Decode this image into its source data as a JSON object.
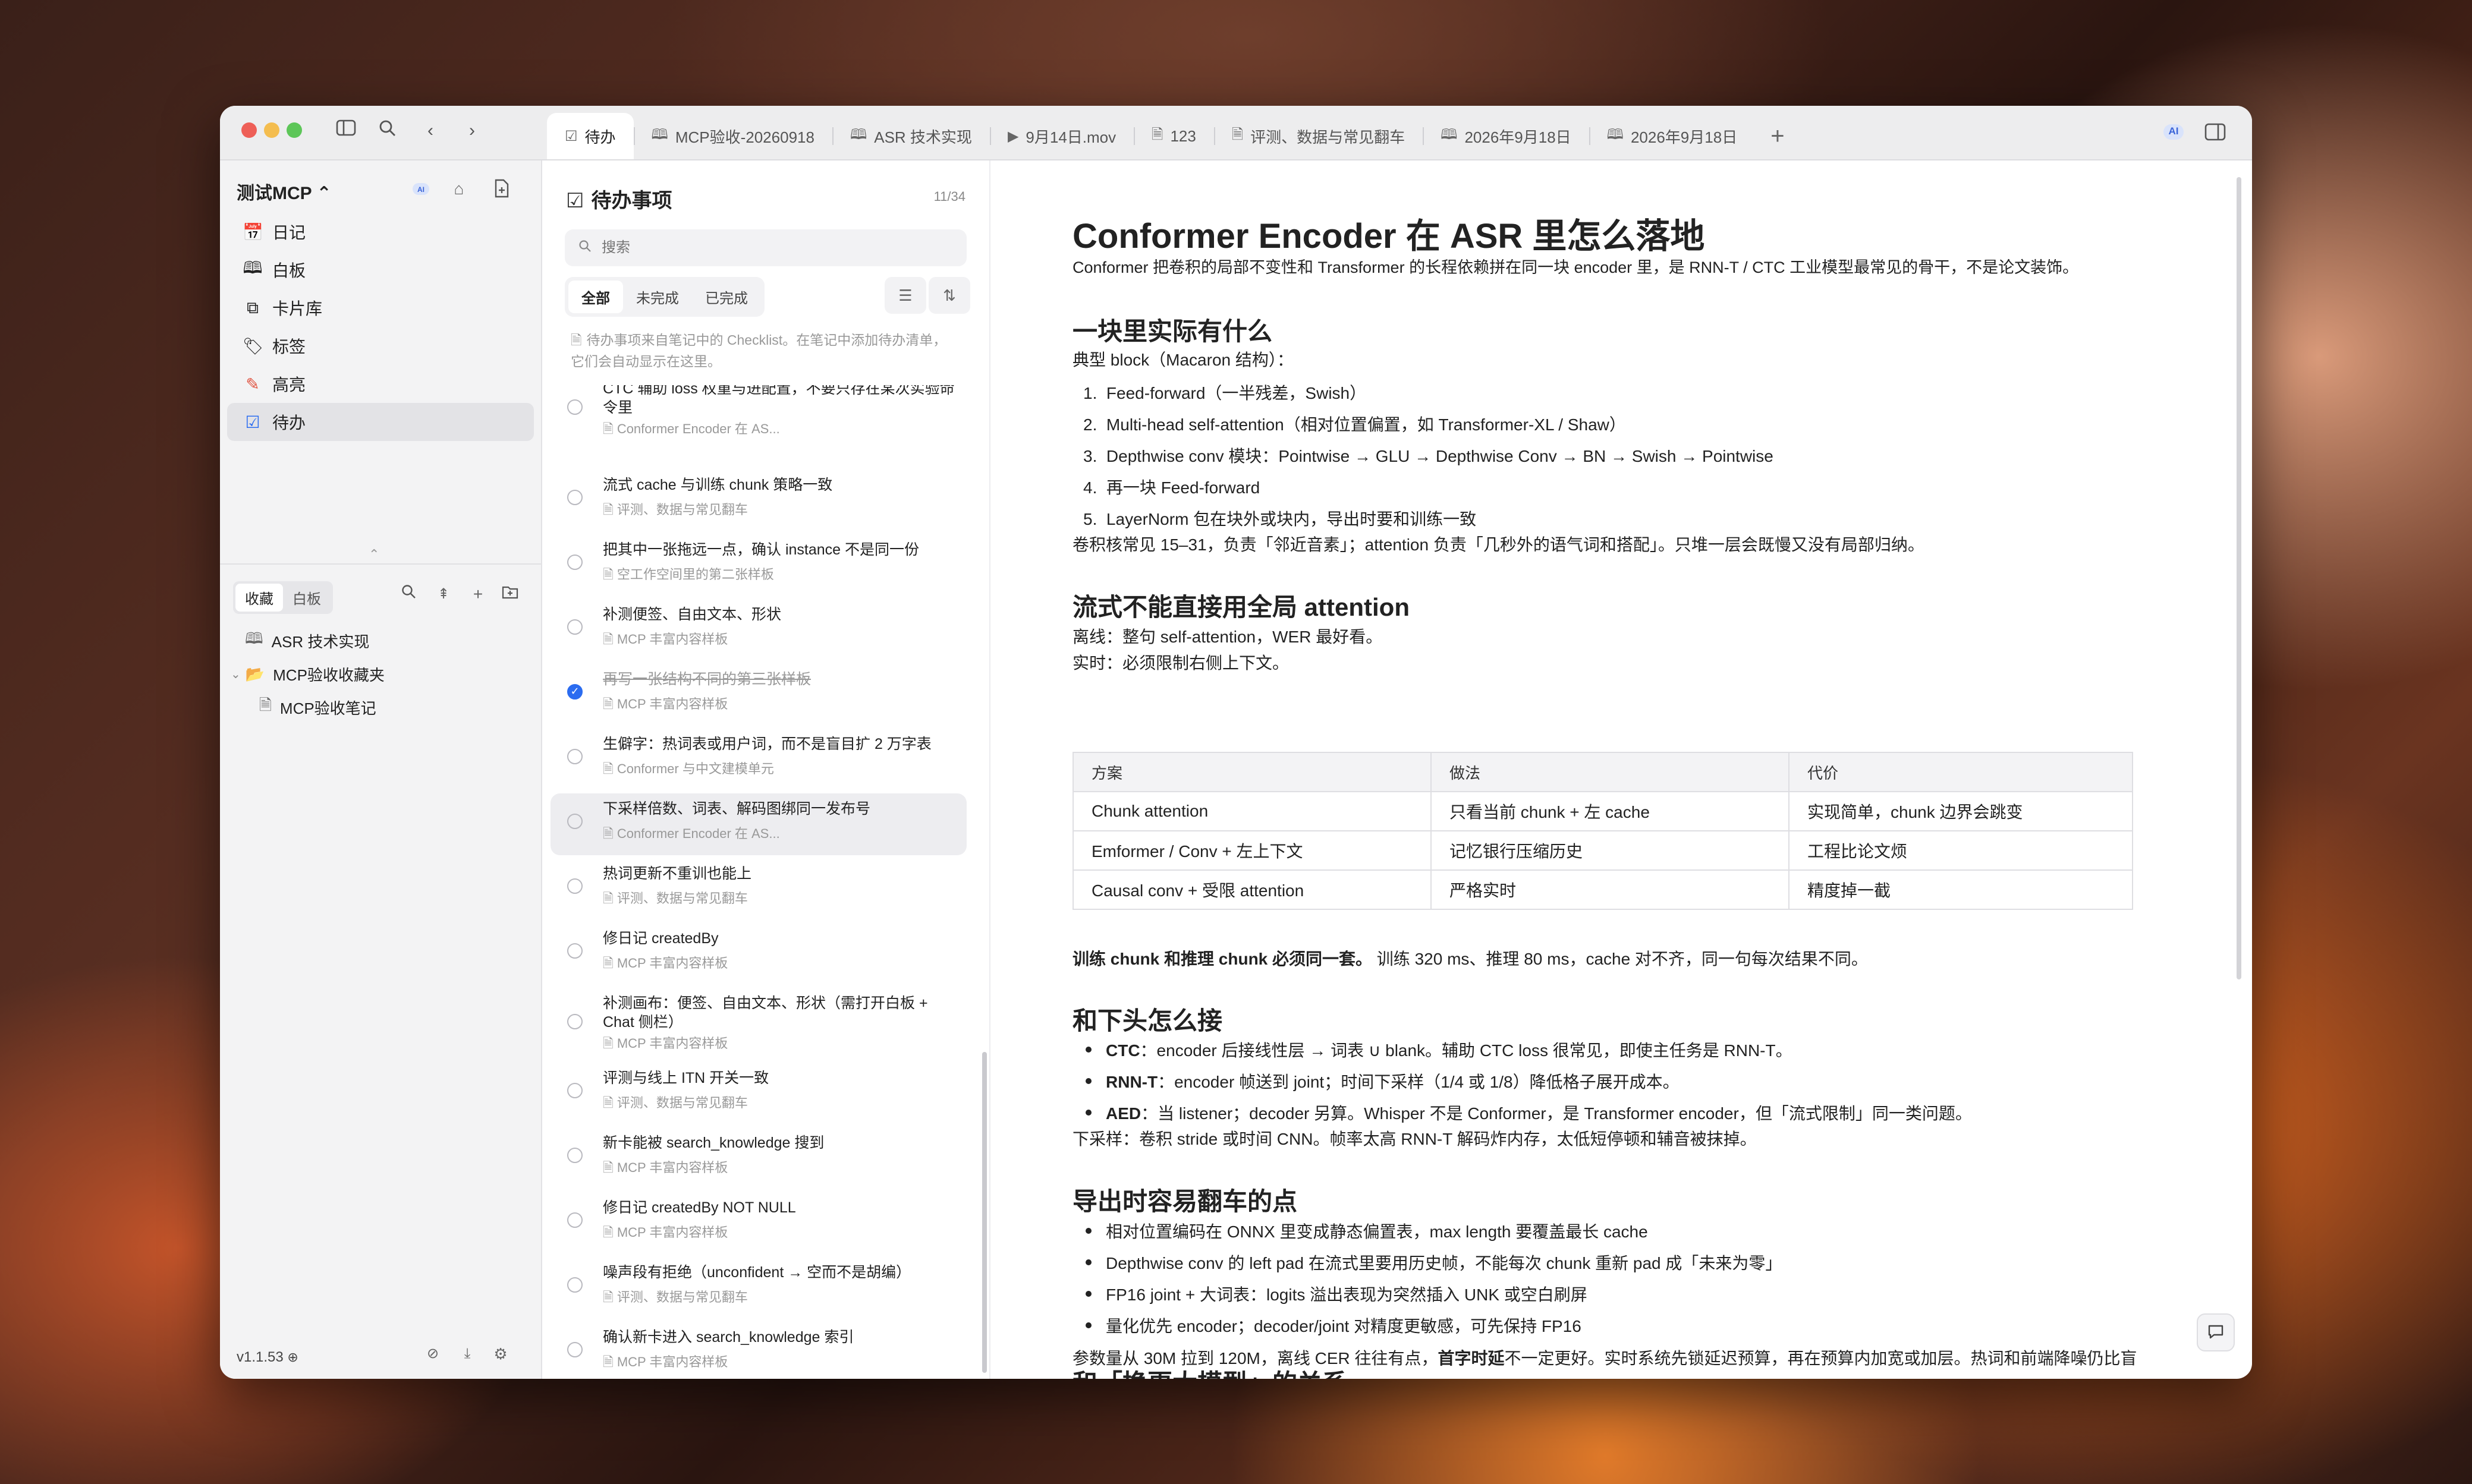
{
  "tabs": [
    {
      "icon": "☑",
      "label": "待办"
    },
    {
      "icon": "🕮",
      "label": "MCP验收-20260918"
    },
    {
      "icon": "🕮",
      "label": "ASR 技术实现"
    },
    {
      "icon": "▶",
      "label": "9月14日.mov"
    },
    {
      "icon": "🗎",
      "label": "123"
    },
    {
      "icon": "🗎",
      "label": "评测、数据与常见翻车"
    },
    {
      "icon": "🕮",
      "label": "2026年9月18日"
    },
    {
      "icon": "🕮",
      "label": "2026年9月18日"
    }
  ],
  "ai_badge": "AI",
  "sidebar": {
    "workspace": "测试MCP ⌃",
    "nav": [
      {
        "icon": "📅",
        "label": "日记"
      },
      {
        "icon": "🕮",
        "label": "白板"
      },
      {
        "icon": "⧉",
        "label": "卡片库"
      },
      {
        "icon": "🏷",
        "label": "标签"
      },
      {
        "icon": "✎",
        "label": "高亮"
      },
      {
        "icon": "☑",
        "label": "待办"
      }
    ],
    "seg": [
      "收藏",
      "白板"
    ],
    "tree": [
      {
        "icon": "🕮",
        "label": "ASR 技术实现"
      },
      {
        "icon": "📂",
        "label": "MCP验收收藏夹"
      },
      {
        "icon": "🗎",
        "label": "MCP验收笔记"
      }
    ],
    "version": "v1.1.53"
  },
  "todo": {
    "title": "待办事项",
    "count": "11/34",
    "search_placeholder": "搜索",
    "filters": [
      "全部",
      "未完成",
      "已完成"
    ],
    "hint": "待办事项来自笔记中的 Checklist。在笔记中添加待办清单，它们会自动显示在这里。",
    "items": [
      {
        "title": "CTC 辅助 loss 权重与进配置，不要只存在某次实验命令里",
        "source": "Conformer Encoder 在 AS...",
        "done": false
      },
      {
        "title": "流式 cache 与训练 chunk 策略一致",
        "source": "评测、数据与常见翻车",
        "done": false
      },
      {
        "title": "把其中一张拖远一点，确认 instance 不是同一份",
        "source": "空工作空间里的第二张样板",
        "done": false
      },
      {
        "title": "补测便签、自由文本、形状",
        "source": "MCP 丰富内容样板",
        "done": false
      },
      {
        "title": "再写一张结构不同的第三张样板",
        "source": "MCP 丰富内容样板",
        "done": true
      },
      {
        "title": "生僻字：热词表或用户词，而不是盲目扩 2 万字表",
        "source": "Conformer 与中文建模单元",
        "done": false
      },
      {
        "title": "下采样倍数、词表、解码图绑同一发布号",
        "source": "Conformer Encoder 在 AS...",
        "done": false
      },
      {
        "title": "热词更新不重训也能上",
        "source": "评测、数据与常见翻车",
        "done": false
      },
      {
        "title": "修日记 createdBy",
        "source": "MCP 丰富内容样板",
        "done": false
      },
      {
        "title": "补测画布：便签、自由文本、形状（需打开白板 + Chat 侧栏）",
        "source": "MCP 丰富内容样板",
        "done": false
      },
      {
        "title": "评测与线上 ITN 开关一致",
        "source": "评测、数据与常见翻车",
        "done": false
      },
      {
        "title": "新卡能被 search_knowledge 搜到",
        "source": "MCP 丰富内容样板",
        "done": false
      },
      {
        "title": "修日记 createdBy NOT NULL",
        "source": "MCP 丰富内容样板",
        "done": false
      },
      {
        "title": "噪声段有拒绝（unconfident → 空而不是胡编）",
        "source": "评测、数据与常见翻车",
        "done": false
      },
      {
        "title": "确认新卡进入 search_knowledge 索引",
        "source": "MCP 丰富内容样板",
        "done": false
      }
    ]
  },
  "doc": {
    "title": "Conformer Encoder 在 ASR 里怎么落地",
    "intro": "Conformer 把卷积的局部不变性和 Transformer 的长程依赖拼在同一块 encoder 里，是 RNN-T / CTC 工业模型最常见的骨干，不是论文装饰。",
    "s1_title": "一块里实际有什么",
    "s1_lead": "典型 block（Macaron 结构）：",
    "s1_list": [
      "Feed-forward（一半残差，Swish）",
      "Multi-head self-attention（相对位置偏置，如 Transformer-XL / Shaw）",
      "Depthwise conv 模块：Pointwise → GLU → Depthwise Conv → BN → Swish → Pointwise",
      "再一块 Feed-forward",
      "LayerNorm 包在块外或块内，导出时要和训练一致"
    ],
    "s1_tail": "卷积核常见 15–31，负责「邻近音素」；attention 负责「几秒外的语气词和搭配」。只堆一层会既慢又没有局部归纳。",
    "s2_title": "流式不能直接用全局 attention",
    "s2_p1": "离线：整句 self-attention，WER 最好看。",
    "s2_p2": "实时：必须限制右侧上下文。",
    "table": {
      "headers": [
        "方案",
        "做法",
        "代价"
      ],
      "rows": [
        [
          "Chunk attention",
          "只看当前 chunk + 左 cache",
          "实现简单，chunk 边界会跳变"
        ],
        [
          "Emformer / Conv + 左上下文",
          "记忆银行压缩历史",
          "工程比论文烦"
        ],
        [
          "Causal conv + 受限 attention",
          "严格实时",
          "精度掉一截"
        ]
      ]
    },
    "s2_bold": "训练 chunk 和推理 chunk 必须同一套。",
    "s2_note": " 训练 320 ms、推理 80 ms，cache 对不齐，同一句每次结果不同。",
    "s3_title": "和下头怎么接",
    "s3_list": [
      {
        "b": "CTC",
        "t": "：encoder 后接线性层 → 词表 ∪ blank。辅助 CTC loss 很常见，即使主任务是 RNN-T。"
      },
      {
        "b": "RNN-T",
        "t": "：encoder 帧送到 joint；时间下采样（1/4 或 1/8）降低格子展开成本。"
      },
      {
        "b": "AED",
        "t": "：当 listener；decoder 另算。Whisper 不是 Conformer，是 Transformer encoder，但「流式限制」同一类问题。"
      }
    ],
    "s3_tail": "下采样：卷积 stride 或时间 CNN。帧率太高 RNN-T 解码炸内存，太低短停顿和辅音被抹掉。",
    "s4_title": "导出时容易翻车的点",
    "s4_list": [
      "相对位置编码在 ONNX 里变成静态偏置表，max length 要覆盖最长 cache",
      "Depthwise conv 的 left pad 在流式里要用历史帧，不能每次 chunk 重新 pad 成「未来为零」",
      "FP16 joint + 大词表：logits 溢出表现为突然插入 UNK 或空白刷屏",
      "量化优先 encoder；decoder/joint 对精度更敏感，可先保持 FP16"
    ],
    "s5_title": "和「换更大模型」的关系",
    "s5_a": "参数量从 30M 拉到 120M，离线 CER 往往有点，",
    "s5_b": "首字时延",
    "s5_c": "不一定更好。实时系统先锁延迟预算，再在预算内加宽或加层。热词和前端降噪仍比盲"
  }
}
